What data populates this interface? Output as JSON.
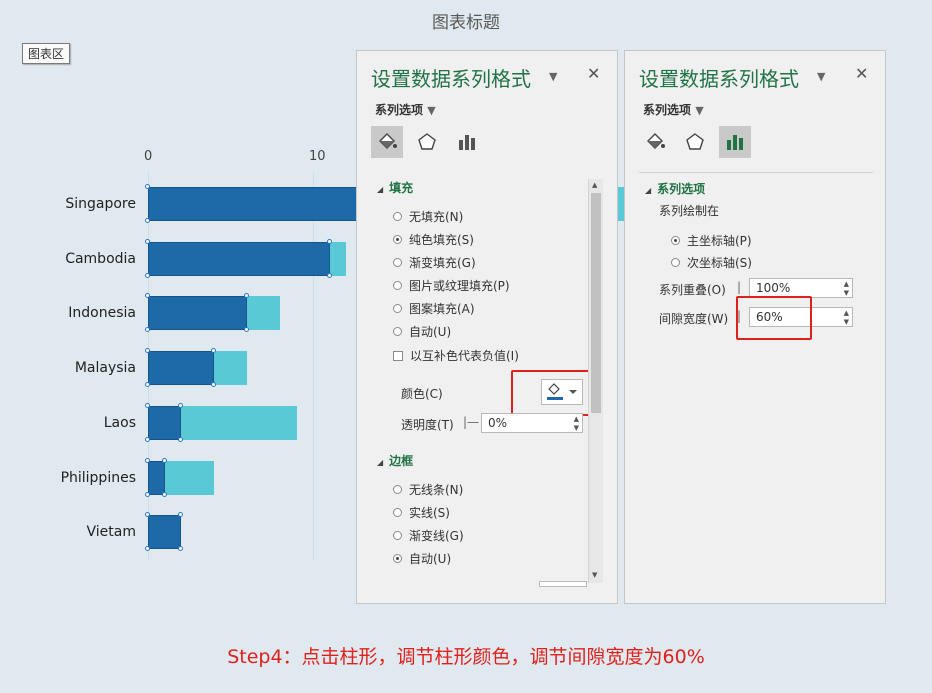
{
  "chart": {
    "title": "图表标题",
    "area_tag": "图表区"
  },
  "chart_data": {
    "type": "bar",
    "orientation": "horizontal",
    "categories": [
      "Singapore",
      "Cambodia",
      "Indonesia",
      "Malaysia",
      "Laos",
      "Philippines",
      "Vietam"
    ],
    "series": [
      {
        "values": [
          15,
          11,
          6,
          4,
          2,
          1,
          2
        ]
      },
      {
        "values": [
          29,
          12,
          8,
          6,
          9,
          4,
          2
        ]
      }
    ],
    "x_ticks": [
      "0",
      "10"
    ],
    "colors": {
      "primary": "#1e6aa8",
      "secondary": "#5ac9d6"
    }
  },
  "panel_left": {
    "title": "设置数据系列格式",
    "sub_title": "系列选项",
    "icons": [
      "paint-bucket-icon",
      "pentagon-icon",
      "bar-chart-icon"
    ],
    "fill_section": "填充",
    "fill_options": [
      "无填充(N)",
      "纯色填充(S)",
      "渐变填充(G)",
      "图片或纹理填充(P)",
      "图案填充(A)",
      "自动(U)"
    ],
    "fill_selected": 1,
    "invert_label": "以互补色代表负值(I)",
    "color_label": "颜色(C)",
    "transparency_label": "透明度(T)",
    "transparency_value": "0%",
    "border_section": "边框",
    "border_options": [
      "无线条(N)",
      "实线(S)",
      "渐变线(G)",
      "自动(U)"
    ],
    "border_selected": 3
  },
  "panel_right": {
    "title": "设置数据系列格式",
    "sub_title": "系列选项",
    "section": "系列选项",
    "plot_on_label": "系列绘制在",
    "axis_options": [
      "主坐标轴(P)",
      "次坐标轴(S)"
    ],
    "axis_selected": 0,
    "overlap_label": "系列重叠(O)",
    "overlap_value": "100%",
    "gap_label": "间隙宽度(W)",
    "gap_value": "60%"
  },
  "caption": "Step4：点击柱形，调节柱形颜色，调节间隙宽度为60%",
  "accent_color": "#217346",
  "highlight_color": "#e0201b"
}
